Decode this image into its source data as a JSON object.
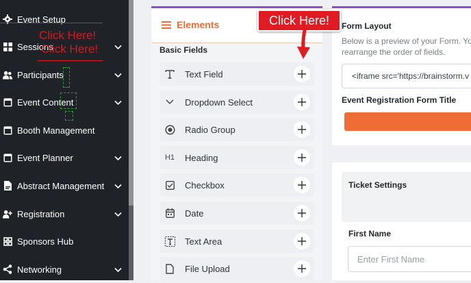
{
  "sidebar": {
    "items": [
      {
        "label": "Event Setup",
        "icon": "gear-icon",
        "chevron": false
      },
      {
        "label": "Sessions",
        "icon": "grid-icon",
        "chevron": true
      },
      {
        "label": "Participants",
        "icon": "users-icon",
        "chevron": true
      },
      {
        "label": "Event Content",
        "icon": "window-icon",
        "chevron": true
      },
      {
        "label": "Booth Management",
        "icon": "window-icon",
        "chevron": false
      },
      {
        "label": "Event Planner",
        "icon": "window-icon",
        "chevron": true
      },
      {
        "label": "Abstract Management",
        "icon": "document-icon",
        "chevron": true
      },
      {
        "label": "Registration",
        "icon": "user-plus-icon",
        "chevron": true
      },
      {
        "label": "Sponsors Hub",
        "icon": "grid-icon",
        "chevron": false
      },
      {
        "label": "Networking",
        "icon": "share-icon",
        "chevron": true
      }
    ]
  },
  "elements_panel": {
    "title": "Elements",
    "section_title": "Basic Fields",
    "fields": [
      {
        "label": "Text Field",
        "icon": "text-t-icon"
      },
      {
        "label": "Dropdown Select",
        "icon": "chevron-down-icon"
      },
      {
        "label": "Radio Group",
        "icon": "radio-icon"
      },
      {
        "label": "Heading",
        "icon": "heading-icon",
        "icon_text": "H1"
      },
      {
        "label": "Checkbox",
        "icon": "checkbox-icon"
      },
      {
        "label": "Date",
        "icon": "calendar-icon"
      },
      {
        "label": "Text Area",
        "icon": "textarea-icon"
      },
      {
        "label": "File Upload",
        "icon": "file-icon"
      }
    ]
  },
  "form_layout": {
    "title": "Form Layout",
    "description_line1": "Below is a preview of your Form. You",
    "description_line2": "rearrange the order of fields.",
    "iframe_code": "<iframe src='https://brainstorm.v",
    "form_title_label": "Event Registration Form Title"
  },
  "ticket": {
    "settings_label": "Ticket Settings",
    "first_name_label": "First Name",
    "first_name_placeholder": "Enter First Name"
  },
  "callout": {
    "text": "Click Here!",
    "ghost_text_1": "Click Here!",
    "ghost_text_2": "Click Here!"
  },
  "colors": {
    "accent": "#ef6c36",
    "callout": "#e11b22",
    "sidebar": "#1f2328",
    "top_strip": "#8a4fd1"
  }
}
